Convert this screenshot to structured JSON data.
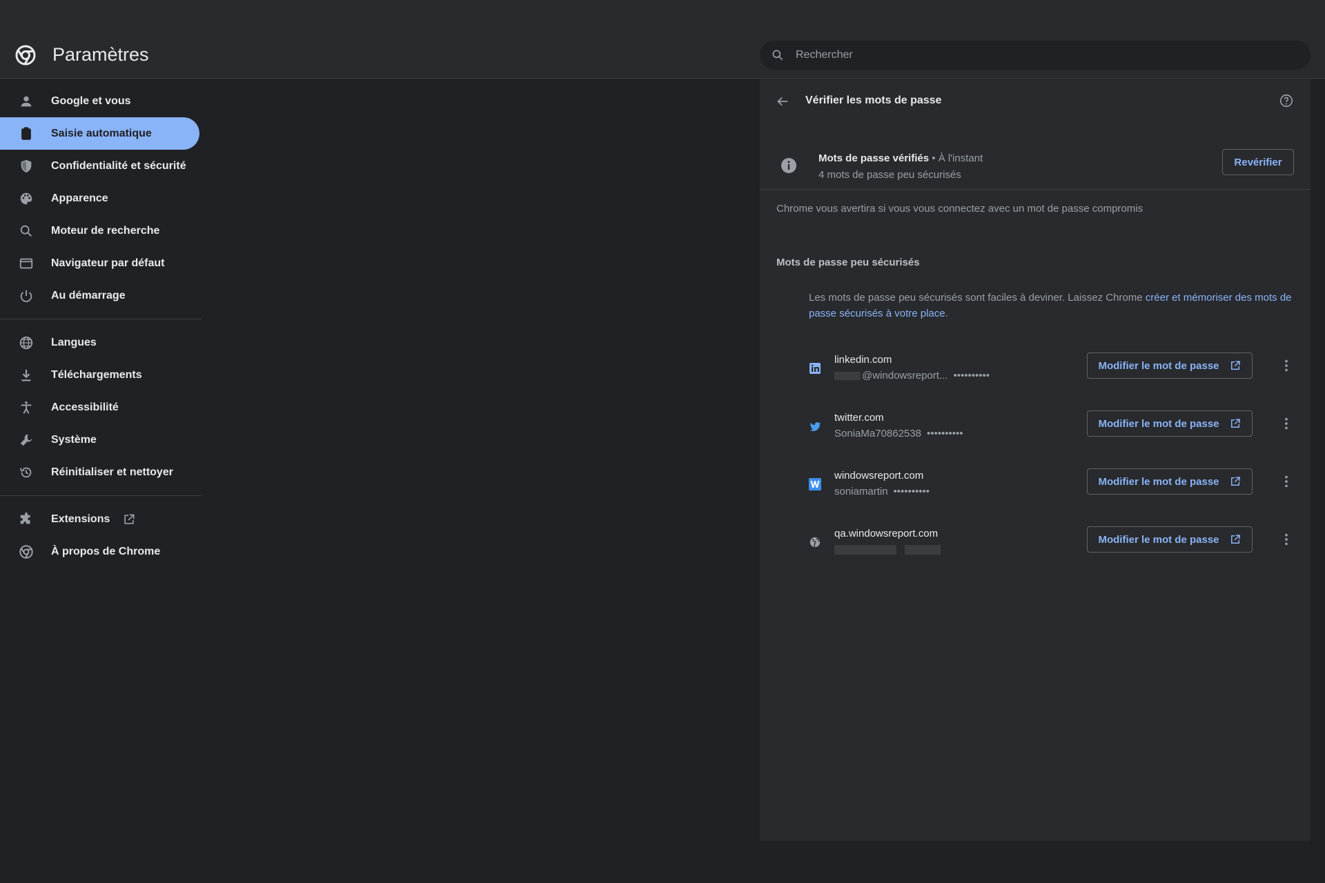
{
  "app": {
    "title": "Paramètres"
  },
  "search": {
    "placeholder": "Rechercher"
  },
  "sidebar": {
    "items": [
      {
        "label": "Google et vous",
        "icon": "person-icon"
      },
      {
        "label": "Saisie automatique",
        "icon": "clipboard-icon",
        "active": true
      },
      {
        "label": "Confidentialité et sécurité",
        "icon": "shield-icon"
      },
      {
        "label": "Apparence",
        "icon": "palette-icon"
      },
      {
        "label": "Moteur de recherche",
        "icon": "search-icon"
      },
      {
        "label": "Navigateur par défaut",
        "icon": "browser-icon"
      },
      {
        "label": "Au démarrage",
        "icon": "power-icon"
      },
      {
        "label": "Langues",
        "icon": "globe-icon"
      },
      {
        "label": "Téléchargements",
        "icon": "download-icon"
      },
      {
        "label": "Accessibilité",
        "icon": "accessibility-icon"
      },
      {
        "label": "Système",
        "icon": "wrench-icon"
      },
      {
        "label": "Réinitialiser et nettoyer",
        "icon": "restore-icon"
      },
      {
        "label": "Extensions",
        "icon": "puzzle-icon"
      },
      {
        "label": "À propos de Chrome",
        "icon": "chrome-icon"
      }
    ]
  },
  "main": {
    "title": "Vérifier les mots de passe",
    "status": {
      "checked": "Mots de passe vérifiés",
      "separator": "•",
      "time": "À l'instant",
      "summary": "4 mots de passe peu sécurisés",
      "recheck_label": "Revérifier"
    },
    "warning_note": "Chrome vous avertira si vous vous connectez avec un mot de passe compromis",
    "weak_section": {
      "title": "Mots de passe peu sécurisés",
      "description": "Les mots de passe peu sécurisés sont faciles à deviner. Laissez Chrome",
      "link": "créer et mémoriser des mots de passe sécurisés à votre place",
      "period": "."
    },
    "passwords": [
      {
        "site": "linkedin.com",
        "user": "@windowsreport...",
        "dots": "••••••••••",
        "icon": "linkedin-icon",
        "color": "#8ab4f8"
      },
      {
        "site": "twitter.com",
        "user": "SoniaMa70862538",
        "dots": "••••••••••",
        "icon": "twitter-icon",
        "color": "#4a9ef0"
      },
      {
        "site": "windowsreport.com",
        "user": "soniamartin",
        "dots": "••••••••••",
        "icon": "windowsreport-icon",
        "color": "#3d8ef0"
      },
      {
        "site": "qa.windowsreport.com",
        "user": "",
        "dots": "",
        "icon": "globe-icon",
        "color": "#9aa0a6"
      }
    ],
    "modify_label": "Modifier le mot de passe"
  }
}
